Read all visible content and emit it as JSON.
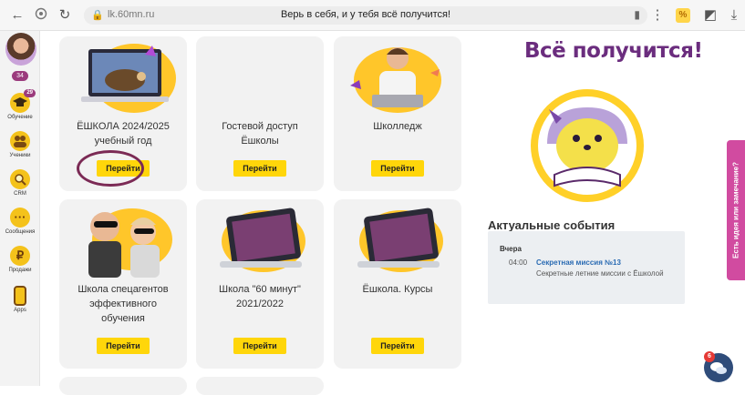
{
  "browser": {
    "domain": "lk.60mn.ru",
    "page_title": "Верь в себя, и у тебя всё получится!",
    "extension_badge": "%"
  },
  "sidebar": {
    "count_pill": "34",
    "items": [
      {
        "label": "Обучение",
        "badge": "29",
        "icon": "graduation-cap-icon"
      },
      {
        "label": "Ученики",
        "icon": "students-icon"
      },
      {
        "label": "CRM",
        "icon": "magnifier-icon"
      },
      {
        "label": "Сообщения",
        "icon": "chat-bubble-icon",
        "glyph": "···"
      },
      {
        "label": "Продажи",
        "icon": "ruble-icon",
        "glyph": "₽"
      },
      {
        "label": "Apps",
        "icon": "phone-icon"
      }
    ]
  },
  "cards": [
    {
      "title_line1": "ЁШКОЛА 2024/2025",
      "title_line2": "учебный год",
      "button": "Перейти"
    },
    {
      "title_line1": "Гостевой доступ",
      "title_line2": "Ёшколы",
      "button": "Перейти"
    },
    {
      "title_line1": "Школледж",
      "title_line2": "",
      "button": "Перейти"
    },
    {
      "title_line1": "Школа спецагентов",
      "title_line2": "эффективного",
      "title_line3": "обучения",
      "button": "Перейти"
    },
    {
      "title_line1": "Школа \"60 минут\"",
      "title_line2": "2021/2022",
      "button": "Перейти"
    },
    {
      "title_line1": "Ёшкола. Курсы",
      "title_line2": "",
      "button": "Перейти"
    }
  ],
  "right_panel": {
    "headline": "Всё получится!",
    "events_title": "Актуальные события",
    "events": [
      {
        "day": "Вчера",
        "time": "04:00",
        "name": "Секретная миссия №13",
        "description": "Секретные летние миссии с Ёшколой"
      }
    ]
  },
  "feedback_tab": "Есть идея или замечание?",
  "chat": {
    "badge": "6"
  },
  "colors": {
    "accent_yellow": "#ffd60a",
    "brand_purple": "#6b2d7e",
    "feedback_pink": "#d14ba0",
    "highlight_ring": "#7b2a55"
  }
}
